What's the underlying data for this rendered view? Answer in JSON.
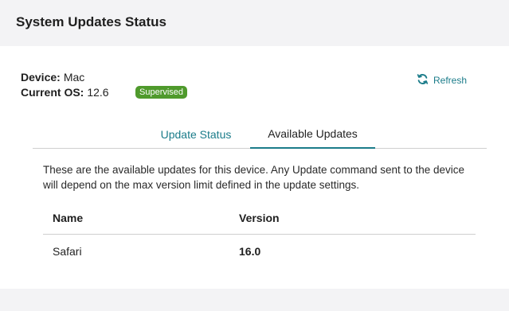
{
  "header": {
    "title": "System Updates Status"
  },
  "device": {
    "device_label": "Device:",
    "device_value": "Mac",
    "os_label": "Current OS:",
    "os_value": "12.6",
    "badge": "Supervised"
  },
  "actions": {
    "refresh_label": "Refresh",
    "refresh_icon": "refresh-icon"
  },
  "colors": {
    "accent": "#1b7c8a",
    "badge": "#4f9a2c"
  },
  "tabs": [
    {
      "label": "Update Status",
      "active": false
    },
    {
      "label": "Available Updates",
      "active": true
    }
  ],
  "description": "These are the available updates for this device. Any Update command sent to the device will depend on the max version limit defined in the update settings.",
  "table": {
    "headers": [
      "Name",
      "Version"
    ],
    "rows": [
      {
        "name": "Safari",
        "version": "16.0"
      }
    ]
  }
}
